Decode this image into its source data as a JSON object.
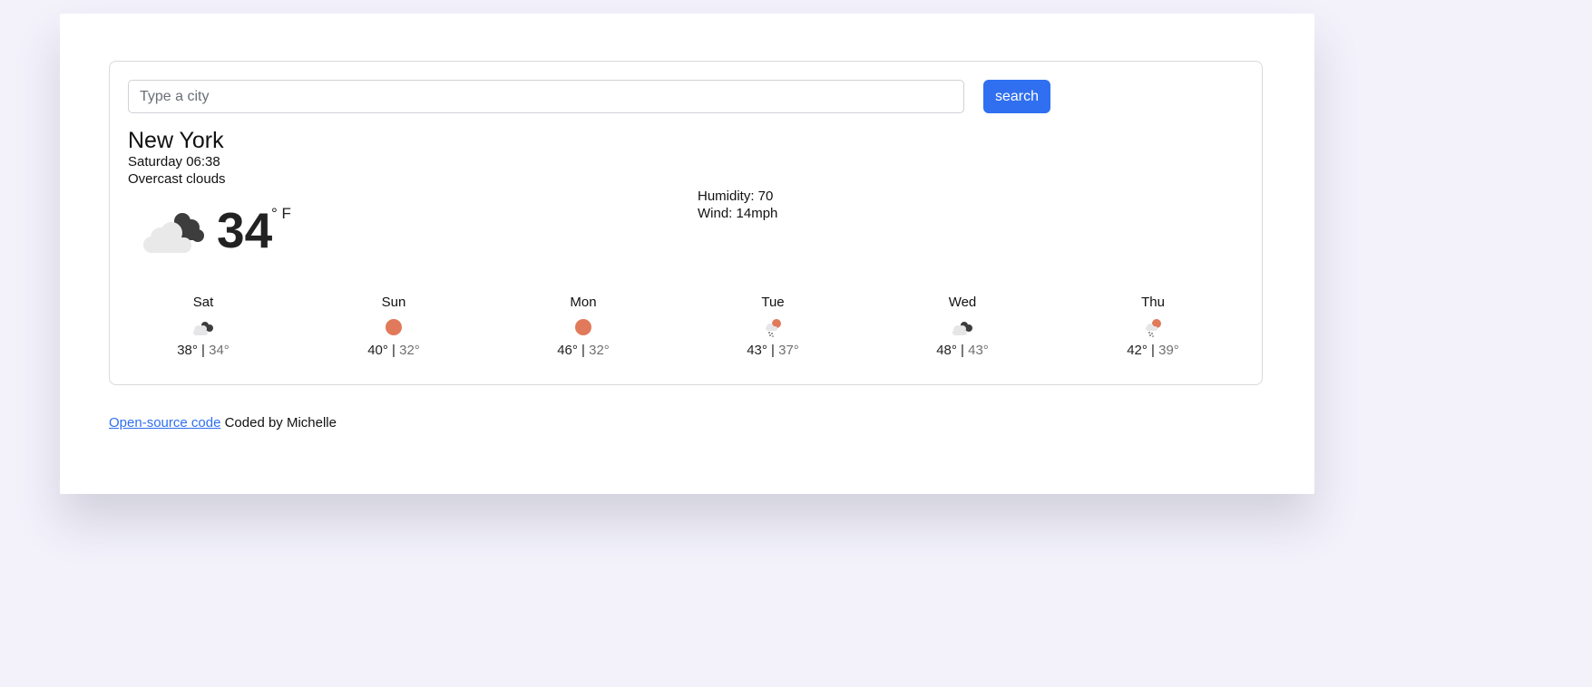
{
  "search": {
    "placeholder": "Type a city",
    "value": "",
    "button_label": "search"
  },
  "current": {
    "city": "New York",
    "date": "Saturday 06:38",
    "description": "Overcast clouds",
    "temperature": "34",
    "unit": "° F",
    "icon": "overcast-clouds-icon",
    "humidity": "Humidity: 70",
    "wind": "Wind: 14mph"
  },
  "forecast": [
    {
      "day": "Sat",
      "max": "38°",
      "min": "34°",
      "icon": "clouds-icon"
    },
    {
      "day": "Sun",
      "max": "40°",
      "min": "32°",
      "icon": "sun-icon"
    },
    {
      "day": "Mon",
      "max": "46°",
      "min": "32°",
      "icon": "sun-icon"
    },
    {
      "day": "Tue",
      "max": "43°",
      "min": "37°",
      "icon": "rain-sun-icon"
    },
    {
      "day": "Wed",
      "max": "48°",
      "min": "43°",
      "icon": "clouds-icon"
    },
    {
      "day": "Thu",
      "max": "42°",
      "min": "39°",
      "icon": "rain-sun-icon"
    }
  ],
  "separator": "|",
  "footer": {
    "link_text": "Open-source code",
    "credit": "Coded by Michelle"
  },
  "colors": {
    "accent": "#2f6ff0",
    "sun": "#e07a5a",
    "background": "#f3f2fb"
  }
}
